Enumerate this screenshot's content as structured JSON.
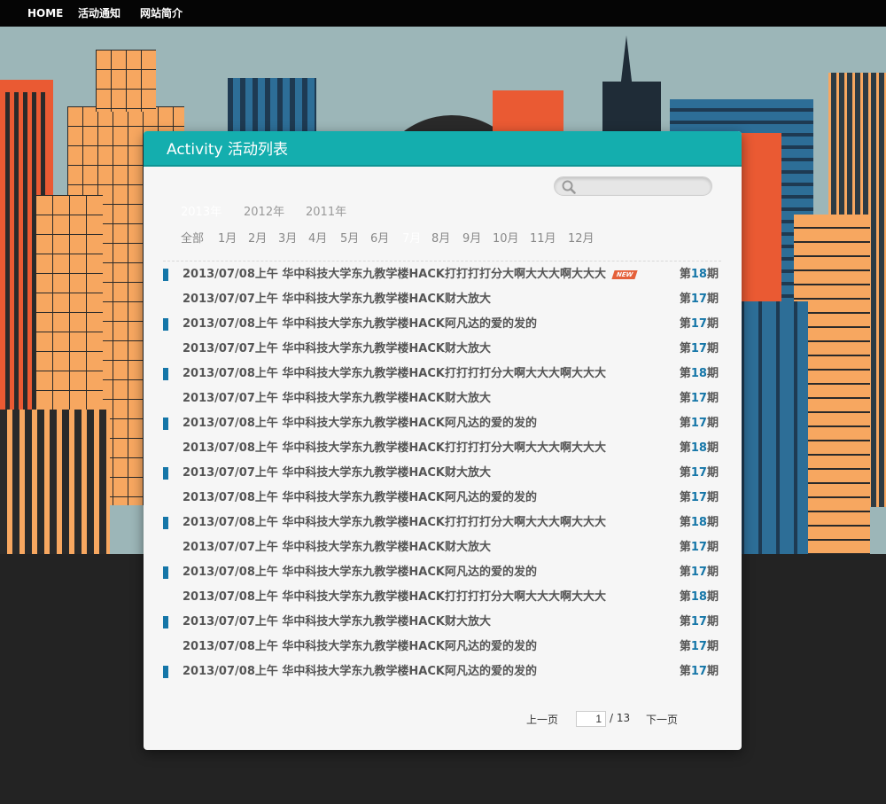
{
  "nav": {
    "items": [
      "HOME",
      "活动通知",
      "网站简介"
    ]
  },
  "panel": {
    "title": "Activity 活动列表",
    "search_placeholder": "",
    "years": [
      "2013年",
      "2012年",
      "2011年"
    ],
    "active_year": "2013年",
    "months": [
      "全部",
      "1月",
      "2月",
      "3月",
      "4月",
      "5月",
      "6月",
      "7月",
      "8月",
      "9月",
      "10月",
      "11月",
      "12月"
    ],
    "active_month": "7月"
  },
  "activities": [
    {
      "text": "2013/07/08上午 华中科技大学东九教学楼HACK打打打打分大啊大大大啊大大大",
      "issue_prefix": "第",
      "issue_no": "18",
      "issue_suffix": "期",
      "marked": true,
      "new": true,
      "new_label": "NEW"
    },
    {
      "text": "2013/07/07上午 华中科技大学东九教学楼HACK财大放大",
      "issue_prefix": "第",
      "issue_no": "17",
      "issue_suffix": "期",
      "marked": false,
      "new": false
    },
    {
      "text": "2013/07/08上午 华中科技大学东九教学楼HACK阿凡达的爱的发的",
      "issue_prefix": "第",
      "issue_no": "17",
      "issue_suffix": "期",
      "marked": true,
      "new": false
    },
    {
      "text": "2013/07/07上午 华中科技大学东九教学楼HACK财大放大",
      "issue_prefix": "第",
      "issue_no": "17",
      "issue_suffix": "期",
      "marked": false,
      "new": false
    },
    {
      "text": "2013/07/08上午 华中科技大学东九教学楼HACK打打打打分大啊大大大啊大大大",
      "issue_prefix": "第",
      "issue_no": "18",
      "issue_suffix": "期",
      "marked": true,
      "new": false
    },
    {
      "text": "2013/07/07上午 华中科技大学东九教学楼HACK财大放大",
      "issue_prefix": "第",
      "issue_no": "17",
      "issue_suffix": "期",
      "marked": false,
      "new": false
    },
    {
      "text": "2013/07/08上午 华中科技大学东九教学楼HACK阿凡达的爱的发的",
      "issue_prefix": "第",
      "issue_no": "17",
      "issue_suffix": "期",
      "marked": true,
      "new": false
    },
    {
      "text": "2013/07/08上午 华中科技大学东九教学楼HACK打打打打分大啊大大大啊大大大",
      "issue_prefix": "第",
      "issue_no": "18",
      "issue_suffix": "期",
      "marked": false,
      "new": false
    },
    {
      "text": "2013/07/07上午 华中科技大学东九教学楼HACK财大放大",
      "issue_prefix": "第",
      "issue_no": "17",
      "issue_suffix": "期",
      "marked": true,
      "new": false
    },
    {
      "text": "2013/07/08上午 华中科技大学东九教学楼HACK阿凡达的爱的发的",
      "issue_prefix": "第",
      "issue_no": "17",
      "issue_suffix": "期",
      "marked": false,
      "new": false
    },
    {
      "text": "2013/07/08上午 华中科技大学东九教学楼HACK打打打打分大啊大大大啊大大大",
      "issue_prefix": "第",
      "issue_no": "18",
      "issue_suffix": "期",
      "marked": true,
      "new": false
    },
    {
      "text": "2013/07/07上午 华中科技大学东九教学楼HACK财大放大",
      "issue_prefix": "第",
      "issue_no": "17",
      "issue_suffix": "期",
      "marked": false,
      "new": false
    },
    {
      "text": "2013/07/08上午 华中科技大学东九教学楼HACK阿凡达的爱的发的",
      "issue_prefix": "第",
      "issue_no": "17",
      "issue_suffix": "期",
      "marked": true,
      "new": false
    },
    {
      "text": "2013/07/08上午 华中科技大学东九教学楼HACK打打打打分大啊大大大啊大大大",
      "issue_prefix": "第",
      "issue_no": "18",
      "issue_suffix": "期",
      "marked": false,
      "new": false
    },
    {
      "text": "2013/07/07上午 华中科技大学东九教学楼HACK财大放大",
      "issue_prefix": "第",
      "issue_no": "17",
      "issue_suffix": "期",
      "marked": true,
      "new": false
    },
    {
      "text": "2013/07/08上午 华中科技大学东九教学楼HACK阿凡达的爱的发的",
      "issue_prefix": "第",
      "issue_no": "17",
      "issue_suffix": "期",
      "marked": false,
      "new": false
    },
    {
      "text": "2013/07/08上午 华中科技大学东九教学楼HACK阿凡达的爱的发的",
      "issue_prefix": "第",
      "issue_no": "17",
      "issue_suffix": "期",
      "marked": true,
      "new": false
    }
  ],
  "pager": {
    "prev_label": "上一页",
    "current_page": "1",
    "total_label": "/ 13",
    "next_label": "下一页"
  },
  "colors": {
    "header_teal": "#14aeae",
    "marker_blue": "#1576a8",
    "new_badge": "#e5603a",
    "building_orange": "#f7a760",
    "building_red": "#ea5a33",
    "building_blue": "#2d6e97",
    "sky": "#9cb6b8"
  }
}
